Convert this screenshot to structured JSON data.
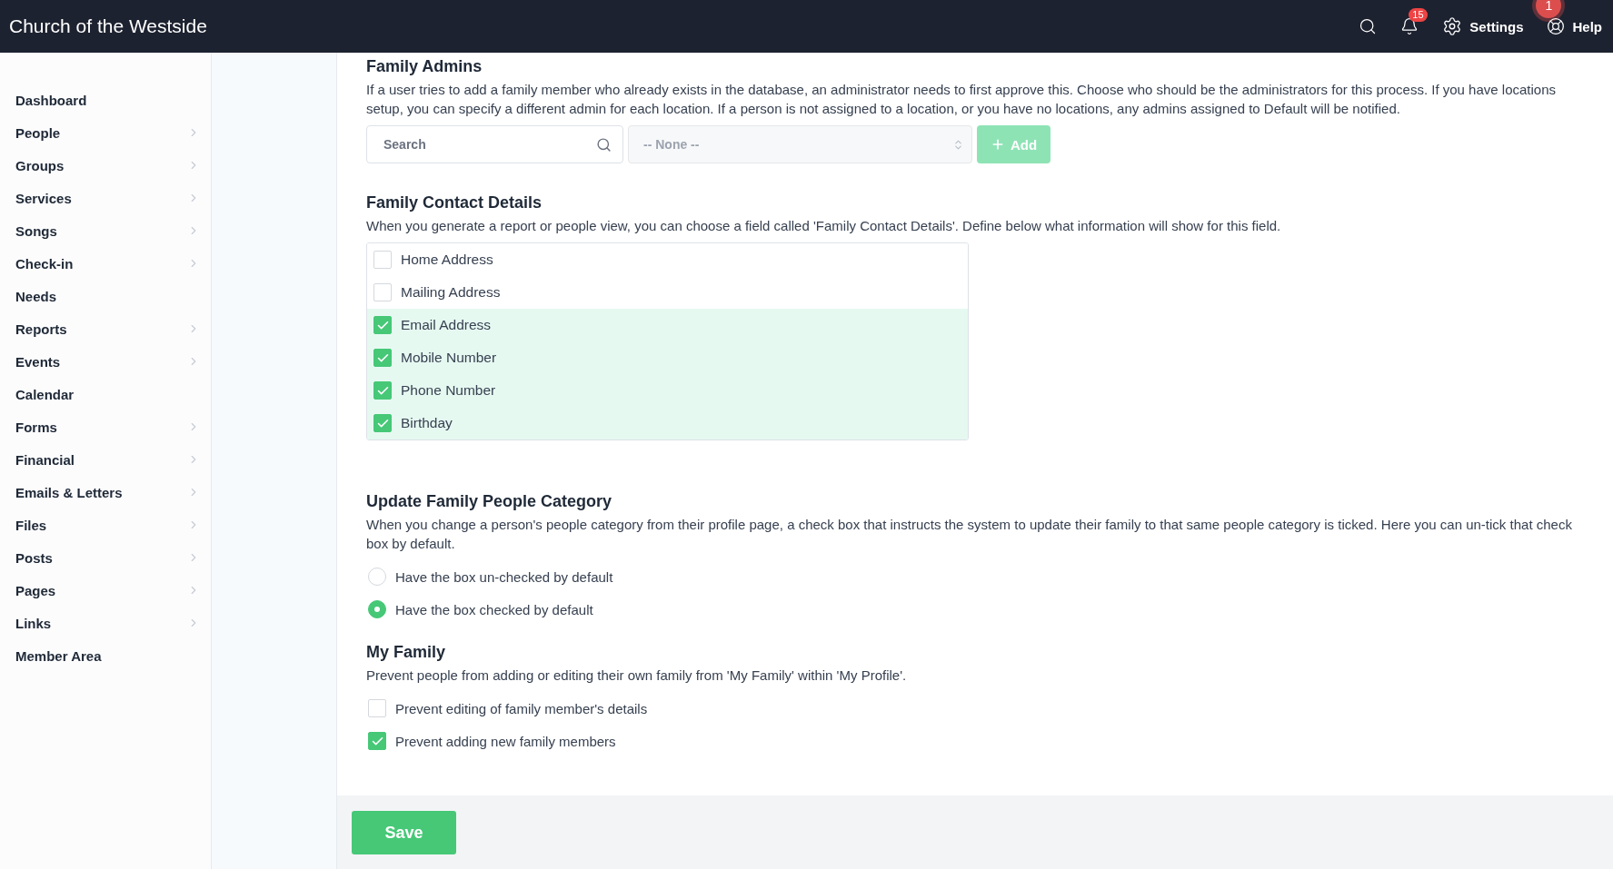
{
  "topbar": {
    "title": "Church of the Westside",
    "notifications_badge": "15",
    "settings_label": "Settings",
    "help_label": "Help",
    "help_badge": "1"
  },
  "sidebar": {
    "items": [
      {
        "label": "Dashboard",
        "has_submenu": false
      },
      {
        "label": "People",
        "has_submenu": true
      },
      {
        "label": "Groups",
        "has_submenu": true
      },
      {
        "label": "Services",
        "has_submenu": true
      },
      {
        "label": "Songs",
        "has_submenu": true
      },
      {
        "label": "Check-in",
        "has_submenu": true
      },
      {
        "label": "Needs",
        "has_submenu": false
      },
      {
        "label": "Reports",
        "has_submenu": true
      },
      {
        "label": "Events",
        "has_submenu": true
      },
      {
        "label": "Calendar",
        "has_submenu": false
      },
      {
        "label": "Forms",
        "has_submenu": true
      },
      {
        "label": "Financial",
        "has_submenu": true
      },
      {
        "label": "Emails & Letters",
        "has_submenu": true
      },
      {
        "label": "Files",
        "has_submenu": true
      },
      {
        "label": "Posts",
        "has_submenu": true
      },
      {
        "label": "Pages",
        "has_submenu": true
      },
      {
        "label": "Links",
        "has_submenu": true
      },
      {
        "label": "Member Area",
        "has_submenu": false
      }
    ]
  },
  "family_admins": {
    "title": "Family Admins",
    "description": "If a user tries to add a family member who already exists in the database, an administrator needs to first approve this. Choose who should be the administrators for this process. If you have locations setup, you can specify a different admin for each location. If a person is not assigned to a location, or you have no locations, any admins assigned to Default will be notified.",
    "search": {
      "placeholder": "Search"
    },
    "select": {
      "value": "-- None --"
    },
    "add_button": "Add"
  },
  "family_contact_details": {
    "title": "Family Contact Details",
    "description": "When you generate a report or people view, you can choose a field called 'Family Contact Details'. Define below what information will show for this field.",
    "options": [
      {
        "label": "Home Address",
        "checked": false
      },
      {
        "label": "Mailing Address",
        "checked": false
      },
      {
        "label": "Email Address",
        "checked": true
      },
      {
        "label": "Mobile Number",
        "checked": true
      },
      {
        "label": "Phone Number",
        "checked": true
      },
      {
        "label": "Birthday",
        "checked": true
      }
    ]
  },
  "update_family_people_category": {
    "title": "Update Family People Category",
    "description": "When you change a person's people category from their profile page, a check box that instructs the system to update their family to that same people category is ticked. Here you can un-tick that check box by default.",
    "options": [
      {
        "label": "Have the box un-checked by default",
        "selected": false
      },
      {
        "label": "Have the box checked by default",
        "selected": true
      }
    ]
  },
  "my_family": {
    "title": "My Family",
    "description": "Prevent people from adding or editing their own family from 'My Family' within 'My Profile'.",
    "options": [
      {
        "label": "Prevent editing of family member's details",
        "checked": false
      },
      {
        "label": "Prevent adding new family members",
        "checked": true
      }
    ]
  },
  "save_button": "Save"
}
